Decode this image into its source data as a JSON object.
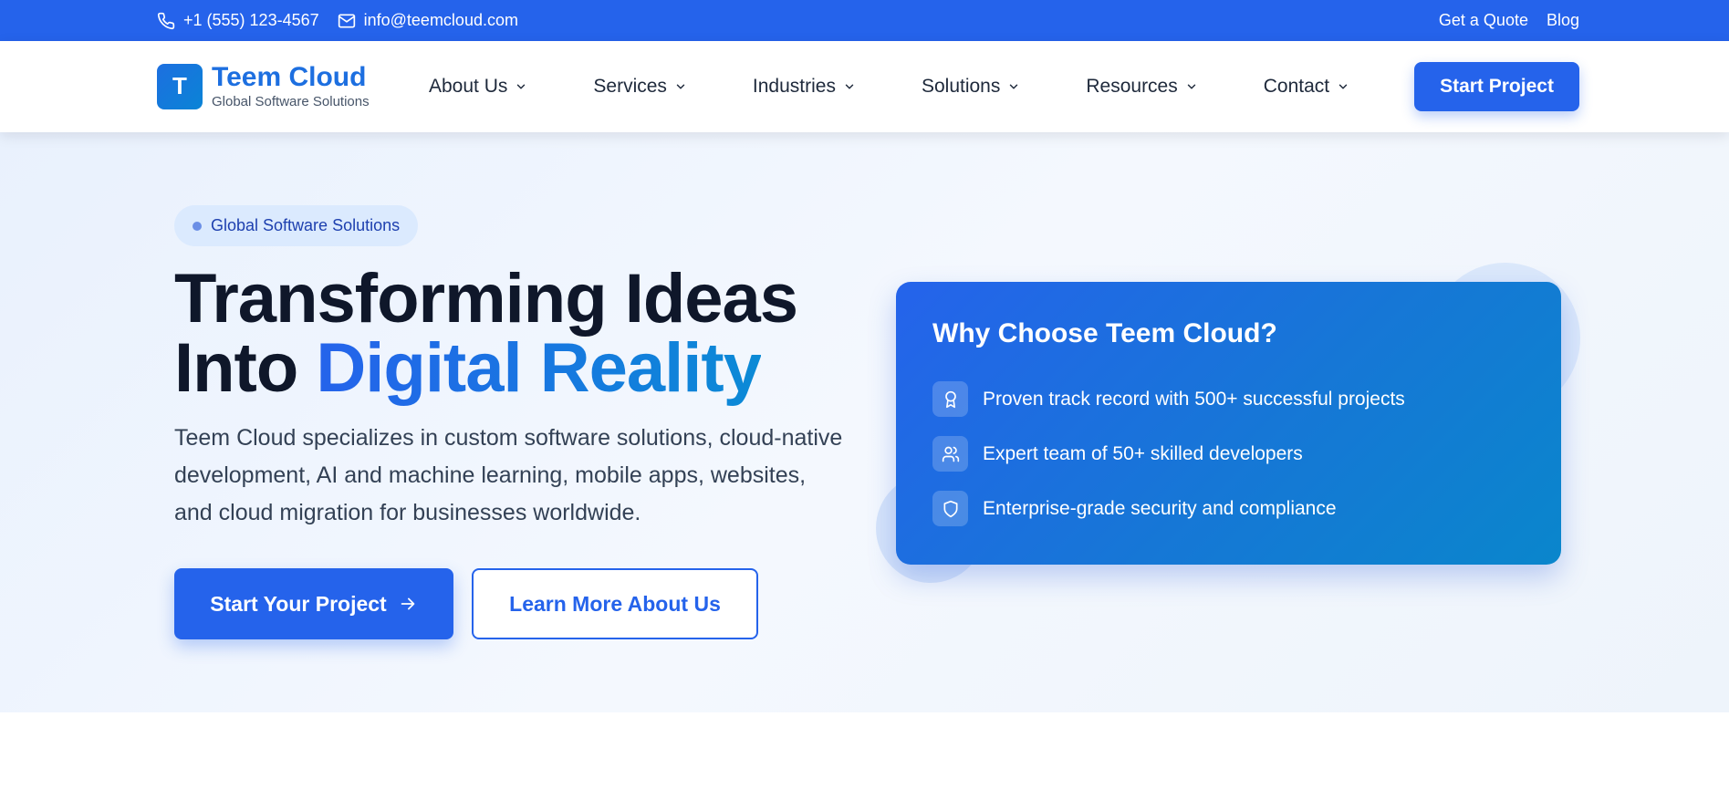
{
  "topbar": {
    "phone": "+1 (555) 123-4567",
    "email": "info@teemcloud.com",
    "links": [
      "Get a Quote",
      "Blog"
    ]
  },
  "brand": {
    "letter": "T",
    "name": "Teem Cloud",
    "tagline": "Global Software Solutions"
  },
  "nav": {
    "items": [
      "About Us",
      "Services",
      "Industries",
      "Solutions",
      "Resources",
      "Contact"
    ],
    "cta": "Start Project"
  },
  "hero": {
    "badge": "Global Software Solutions",
    "headline_line1": "Transforming Ideas",
    "headline_line2_prefix": "Into ",
    "headline_line2_accent": "Digital Reality",
    "description": "Teem Cloud specializes in custom software solutions, cloud-native development, AI and machine learning, mobile apps, websites, and cloud migration for businesses worldwide.",
    "primary_button": "Start Your Project",
    "secondary_button": "Learn More About Us"
  },
  "why_card": {
    "title": "Why Choose Teem Cloud?",
    "features": [
      {
        "icon": "award-icon",
        "text": "Proven track record with 500+ successful projects"
      },
      {
        "icon": "users-icon",
        "text": "Expert team of 50+ skilled developers"
      },
      {
        "icon": "shield-icon",
        "text": "Enterprise-grade security and compliance"
      }
    ]
  },
  "colors": {
    "primary": "#2563eb",
    "brand_blue": "#1d6fe0",
    "accent_end": "#0b8ad6",
    "text_dark": "#0f172a",
    "hero_bg": "#eef4fd"
  }
}
